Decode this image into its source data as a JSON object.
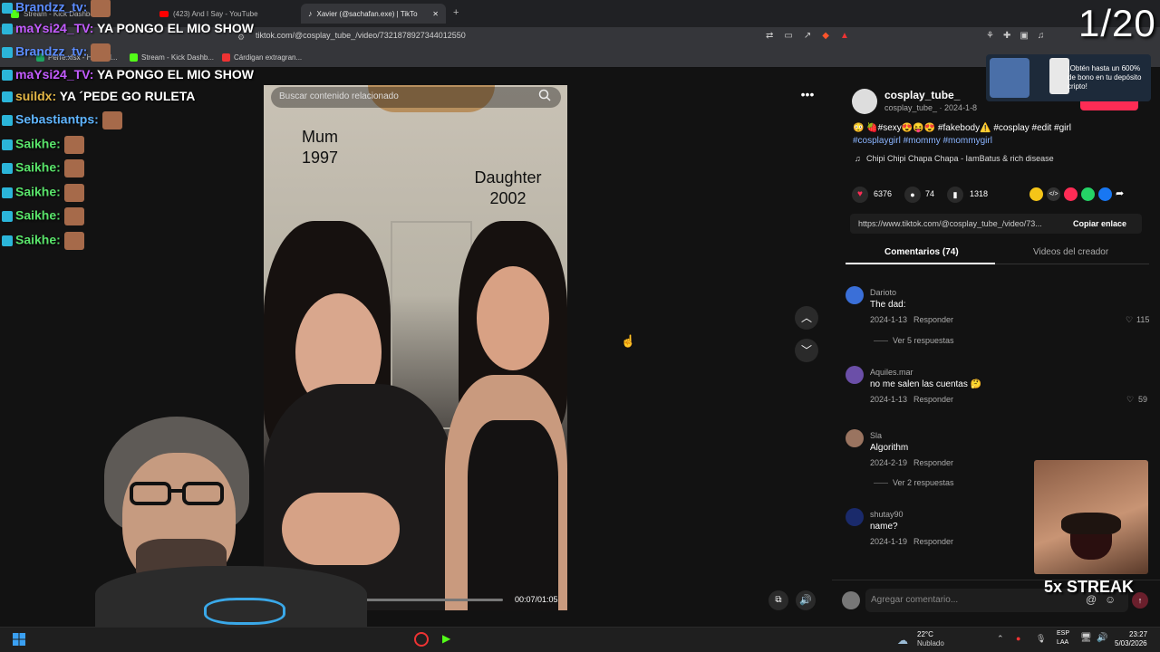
{
  "browser": {
    "tabs": [
      {
        "label": "Stream - Kick Dashboard"
      },
      {
        "label": "(423) And I Say - YouTube"
      },
      {
        "label": "Xavier (@sachafan.exe) | TikTo"
      }
    ],
    "url": "tiktok.com/@cosplay_tube_/video/7321878927344012550",
    "bookmarks": [
      "Perre.xlsx - Hojas d...",
      "Stream - Kick Dashb...",
      "Cárdigan extragran..."
    ]
  },
  "overlay": {
    "counter": "1/20",
    "streak": "5x STREAK",
    "ad_text": "¡Obtén hasta un 600% de bono en tu depósito cripto!"
  },
  "chat": [
    {
      "user": "Brandzz_tv:",
      "text": "",
      "color": "#5b8cff"
    },
    {
      "user": "maYsi24_TV:",
      "text": "YA PONGO EL MIO SHOW",
      "color": "#c35bff"
    },
    {
      "user": "Brandzz_tv:",
      "text": "",
      "color": "#5b8cff"
    },
    {
      "user": "maYsi24_TV:",
      "text": "YA PONGO EL MIO SHOW",
      "color": "#c35bff"
    },
    {
      "user": "suildx:",
      "text": "YA ´PEDE GO RULETA",
      "color": "#e3b646"
    },
    {
      "user": "Sebastiantps:",
      "text": "",
      "color": "#5fb5ff"
    },
    {
      "user": "Saikhe:",
      "text": "",
      "color": "#59e36a"
    },
    {
      "user": "Saikhe:",
      "text": "",
      "color": "#59e36a"
    },
    {
      "user": "Saikhe:",
      "text": "",
      "color": "#59e36a"
    },
    {
      "user": "Saikhe:",
      "text": "",
      "color": "#59e36a"
    },
    {
      "user": "Saikhe:",
      "text": "",
      "color": "#59e36a"
    }
  ],
  "video": {
    "search_placeholder": "Buscar contenido relacionado",
    "label_left_1": "Mum",
    "label_left_2": "1997",
    "label_right_1": "Daughter",
    "label_right_2": "2002",
    "time": "00:07/01:05",
    "progress": 0.11
  },
  "post": {
    "username": "cosplay_tube_",
    "handle_date": "cosplay_tube_ · 2024-1-8",
    "caption_line1": "😳 🍓#sexy😍😝😍 #fakebody⚠️ #cosplay #edit #girl",
    "caption_line2": "#cosplaygirl #mommy #mommygirl",
    "music": "Chipi Chipi Chapa Chapa - IamBatus & rich disease",
    "likes": "6376",
    "comments": "74",
    "saves": "1318",
    "link": "https://www.tiktok.com/@cosplay_tube_/video/73...",
    "copy_label": "Copiar enlace",
    "tab_comments": "Comentarios (74)",
    "tab_creator": "Videos del creador",
    "add_comment_placeholder": "Agregar comentario..."
  },
  "comments": [
    {
      "name": "Darioto",
      "text": "The dad:",
      "date": "2024-1-13",
      "reply": "Responder",
      "likes": "115",
      "replies": "Ver 5 respuestas"
    },
    {
      "name": "Aquiles.mar",
      "text": "no me salen las cuentas 🤔",
      "date": "2024-1-13",
      "reply": "Responder",
      "likes": "59",
      "replies": ""
    },
    {
      "name": "Sla",
      "text": "Algorithm",
      "date": "2024-2-19",
      "reply": "Responder",
      "likes": "",
      "replies": "Ver 2 respuestas"
    },
    {
      "name": "shutay90",
      "text": "name?",
      "date": "2024-1-19",
      "reply": "Responder",
      "likes": "",
      "replies": ""
    }
  ],
  "taskbar": {
    "temp": "22°C",
    "weather": "Nublado",
    "lang1": "ESP",
    "lang2": "LAA",
    "time": "23:27",
    "date": "5/03/2026"
  },
  "colors": {
    "accent": "#fe2c55",
    "link": "#8ab4ff"
  }
}
